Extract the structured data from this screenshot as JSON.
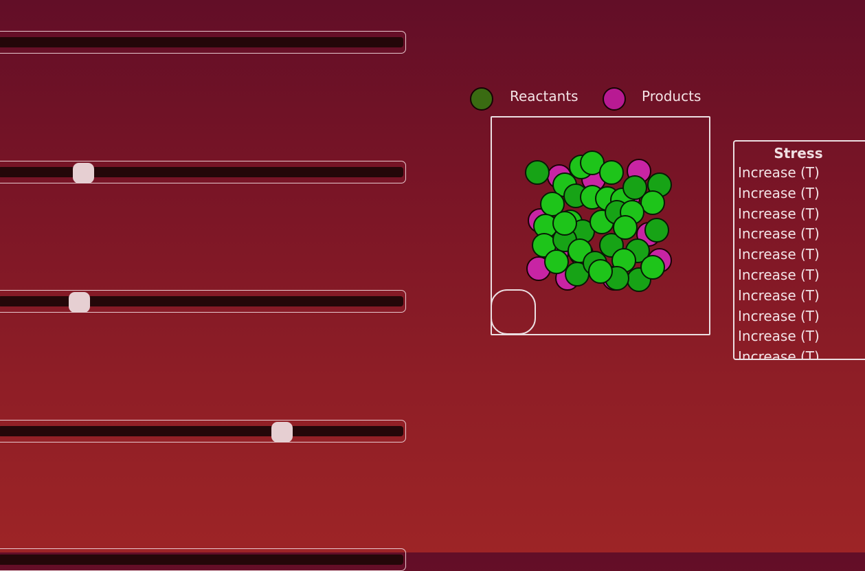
{
  "sliders": [
    {
      "name": "slider-1",
      "value": null
    },
    {
      "name": "slider-2",
      "value": 0.21
    },
    {
      "name": "slider-3",
      "value": 0.2
    },
    {
      "name": "slider-4",
      "value": 0.7
    }
  ],
  "legend": {
    "reactants": {
      "label": "Reactants",
      "color": "#3a6b12"
    },
    "products": {
      "label": "Products",
      "color": "#b81a93"
    }
  },
  "colors": {
    "reactant_particle": "#1ec41a",
    "product_particle": "#c824a4"
  },
  "stress": {
    "title": "Stress",
    "rows": [
      "Increase (T)",
      "Increase (T)",
      "Increase (T)",
      "Increase (T)",
      "Increase (T)",
      "Increase (T)",
      "Increase (T)",
      "Increase (T)",
      "Increase (T)",
      "Increase (T)"
    ]
  }
}
